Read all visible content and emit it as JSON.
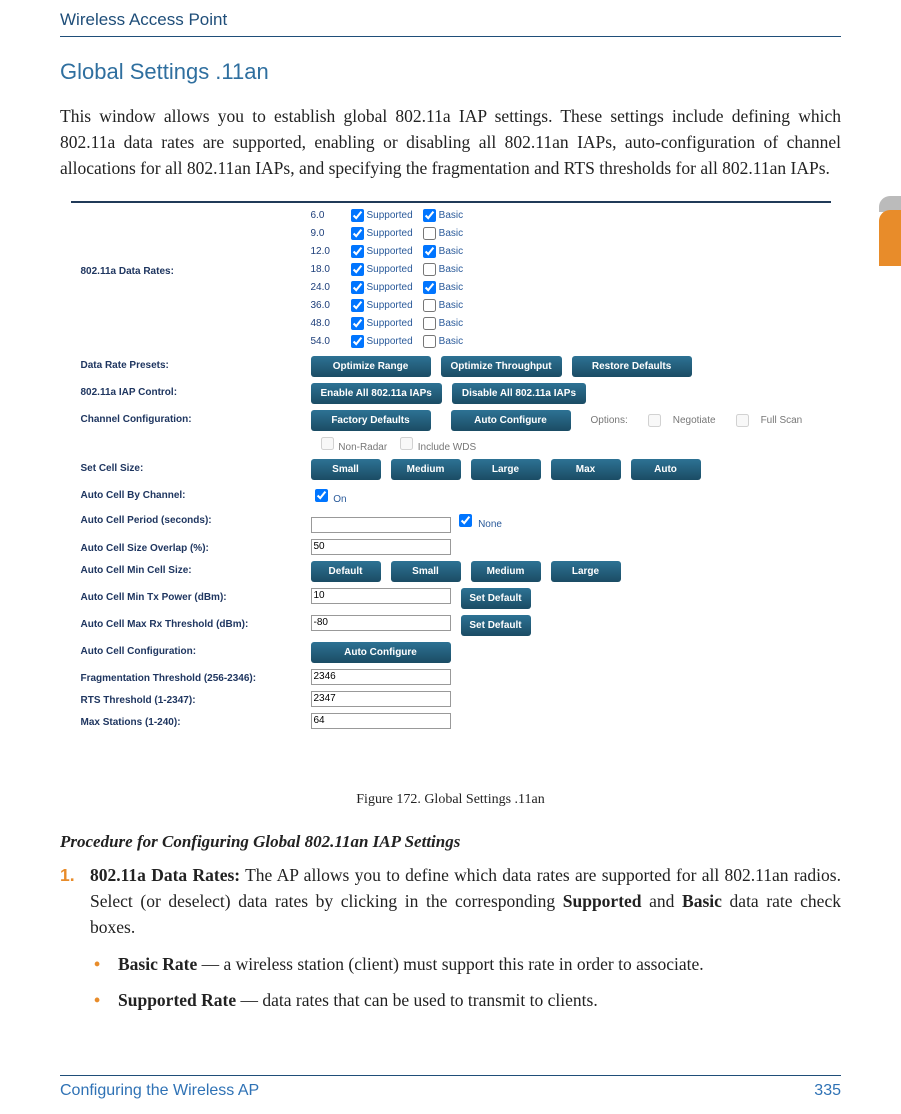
{
  "header": {
    "title": "Wireless Access Point"
  },
  "section_title": "Global Settings .11an",
  "intro": "This window allows you to establish global 802.11a IAP settings. These settings include defining which 802.11a data rates are supported, enabling or disabling all 802.11an IAPs, auto-configuration of channel allocations for all 802.11an IAPs, and specifying the fragmentation and RTS thresholds for all 802.11an IAPs.",
  "ui": {
    "labels": {
      "data_rates": "802.11a Data Rates:",
      "presets": "Data Rate Presets:",
      "iap_control": "802.11a IAP Control:",
      "chan_config": "Channel Configuration:",
      "cell_size": "Set Cell Size:",
      "auto_cell_by_channel": "Auto Cell By Channel:",
      "auto_cell_period": "Auto Cell Period (seconds):",
      "auto_cell_overlap": "Auto Cell Size Overlap (%):",
      "auto_cell_min_cell": "Auto Cell Min Cell Size:",
      "auto_cell_min_tx": "Auto Cell Min Tx Power (dBm):",
      "auto_cell_max_rx": "Auto Cell Max Rx Threshold (dBm):",
      "auto_cell_config": "Auto Cell Configuration:",
      "frag": "Fragmentation Threshold (256-2346):",
      "rts": "RTS Threshold (1-2347):",
      "max_stations": "Max Stations (1-240):"
    },
    "rates": [
      {
        "v": "6.0",
        "supported": true,
        "basic": true
      },
      {
        "v": "9.0",
        "supported": true,
        "basic": false
      },
      {
        "v": "12.0",
        "supported": true,
        "basic": true
      },
      {
        "v": "18.0",
        "supported": true,
        "basic": false
      },
      {
        "v": "24.0",
        "supported": true,
        "basic": true
      },
      {
        "v": "36.0",
        "supported": true,
        "basic": false
      },
      {
        "v": "48.0",
        "supported": true,
        "basic": false
      },
      {
        "v": "54.0",
        "supported": true,
        "basic": false
      }
    ],
    "rate_col": {
      "supported": "Supported",
      "basic": "Basic"
    },
    "buttons": {
      "opt_range": "Optimize Range",
      "opt_thru": "Optimize Throughput",
      "restore": "Restore Defaults",
      "enable_all": "Enable All 802.11a IAPs",
      "disable_all": "Disable All 802.11a IAPs",
      "factory": "Factory Defaults",
      "auto_cfg": "Auto Configure",
      "small": "Small",
      "medium": "Medium",
      "large": "Large",
      "max": "Max",
      "auto": "Auto",
      "default": "Default",
      "set_default": "Set Default"
    },
    "chan_opts": {
      "options": "Options:",
      "negotiate": "Negotiate",
      "full_scan": "Full Scan",
      "non_radar": "Non-Radar",
      "include_wds": "Include WDS"
    },
    "auto_cell_by_channel": {
      "on": "On"
    },
    "auto_cell_period": {
      "none": "None"
    },
    "values": {
      "overlap": "50",
      "min_tx": "10",
      "max_rx": "-80",
      "frag": "2346",
      "rts": "2347",
      "max_stations": "64"
    }
  },
  "figcap": "Figure 172. Global Settings  .11an",
  "proc_heading": "Procedure for Configuring Global 802.11an IAP Settings",
  "step1": {
    "num": "1.",
    "strong": "802.11a Data Rates:",
    "rest1": " The AP allows you to define which data rates are supported for all 802.11an radios. Select (or deselect) data rates by clicking in the corresponding ",
    "s_word": "Supported",
    "and": " and ",
    "b_word": "Basic",
    "rest2": " data rate check boxes.",
    "sub1": {
      "strong": "Basic Rate",
      "text": " — a wireless station (client) must support this rate in order to associate."
    },
    "sub2": {
      "strong": "Supported Rate",
      "text": " — data rates that can be used to transmit to clients."
    }
  },
  "footer": {
    "left": "Configuring the Wireless AP",
    "right": "335"
  }
}
